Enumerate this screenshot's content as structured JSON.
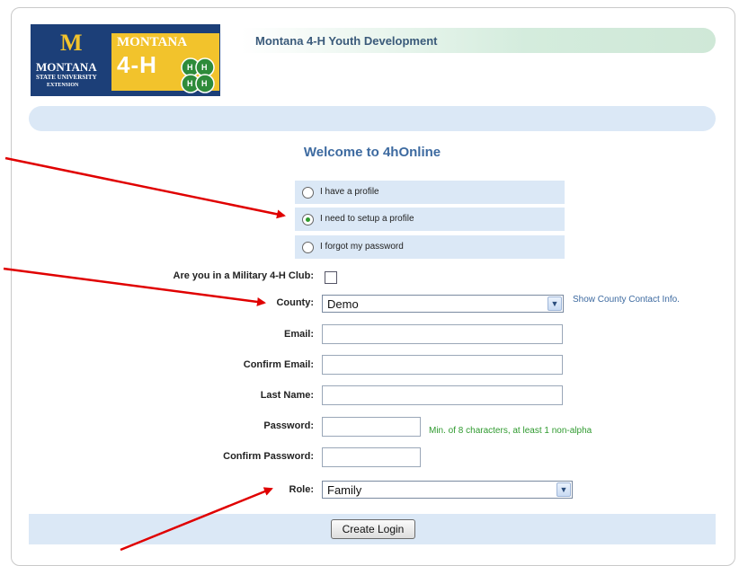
{
  "logo": {
    "msu_letter": "M",
    "msu_line1": "MONTANA",
    "msu_line2": "STATE UNIVERSITY",
    "msu_line3": "EXTENSION",
    "gold_line1": "MONTANA",
    "gold_line2": "4-H"
  },
  "header": {
    "title": "Montana 4-H Youth Development"
  },
  "welcome": "Welcome to 4hOnline",
  "radios": [
    {
      "label": "I have a profile",
      "checked": false
    },
    {
      "label": "I need to setup a profile",
      "checked": true
    },
    {
      "label": "I forgot my password",
      "checked": false
    }
  ],
  "form": {
    "military_label": "Are you in a Military 4-H Club:",
    "county_label": "County:",
    "county_value": "Demo",
    "county_link": "Show County Contact Info.",
    "email_label": "Email:",
    "confirm_email_label": "Confirm Email:",
    "last_name_label": "Last Name:",
    "password_label": "Password:",
    "password_hint": "Min. of 8 characters, at least 1 non-alpha",
    "confirm_password_label": "Confirm Password:",
    "role_label": "Role:",
    "role_value": "Family",
    "submit_label": "Create Login"
  },
  "colors": {
    "accent_blue": "#3d6aa0",
    "panel_blue": "#dbe8f6",
    "hint_green": "#2f9a2f",
    "annotation_red": "#e00000"
  }
}
